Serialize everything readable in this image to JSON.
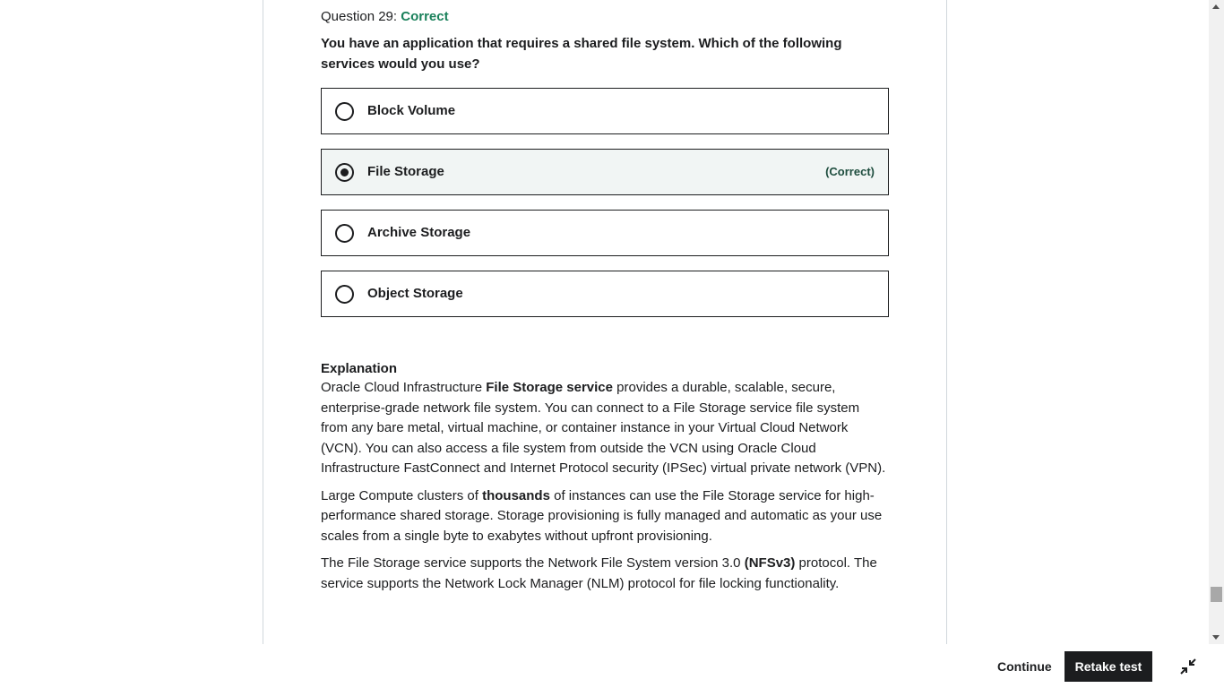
{
  "question": {
    "number_label": "Question 29:",
    "status": "Correct",
    "prompt": "You have an application that requires a shared file system. Which of the following services would you use?",
    "options": [
      {
        "label": "Block Volume",
        "selected": false,
        "tag": ""
      },
      {
        "label": "File Storage",
        "selected": true,
        "tag": "(Correct)"
      },
      {
        "label": "Archive Storage",
        "selected": false,
        "tag": ""
      },
      {
        "label": "Object Storage",
        "selected": false,
        "tag": ""
      }
    ]
  },
  "explanation": {
    "heading": "Explanation",
    "p1": {
      "a": "Oracle Cloud Infrastructure ",
      "b": "File Storage service",
      "c": " provides a durable, scalable, secure, enterprise-grade network file system. You can connect to a File Storage service file system from any bare metal, virtual machine, or container instance in your Virtual Cloud Network (VCN). You can also access a file system from outside the VCN using Oracle Cloud Infrastructure FastConnect and Internet Protocol security (IPSec) virtual private network (VPN)."
    },
    "p2": {
      "a": "Large Compute clusters of ",
      "b": "thousands",
      "c": " of instances can use the File Storage service for high-performance shared storage. Storage provisioning is fully managed and automatic as your use scales from a single byte to exabytes without upfront provisioning."
    },
    "p3": {
      "a": "The File Storage service supports the Network File System version 3.0 ",
      "b": "(NFSv3)",
      "c": " protocol. The service supports the Network Lock Manager (NLM) protocol for file locking functionality."
    }
  },
  "footer": {
    "continue_label": "Continue",
    "retake_label": "Retake test",
    "collapse_icon": "collapse-icon"
  },
  "colors": {
    "correct_text": "#19805a",
    "selected_bg": "#f1f5f4",
    "primary_button": "#1c1d1f"
  }
}
